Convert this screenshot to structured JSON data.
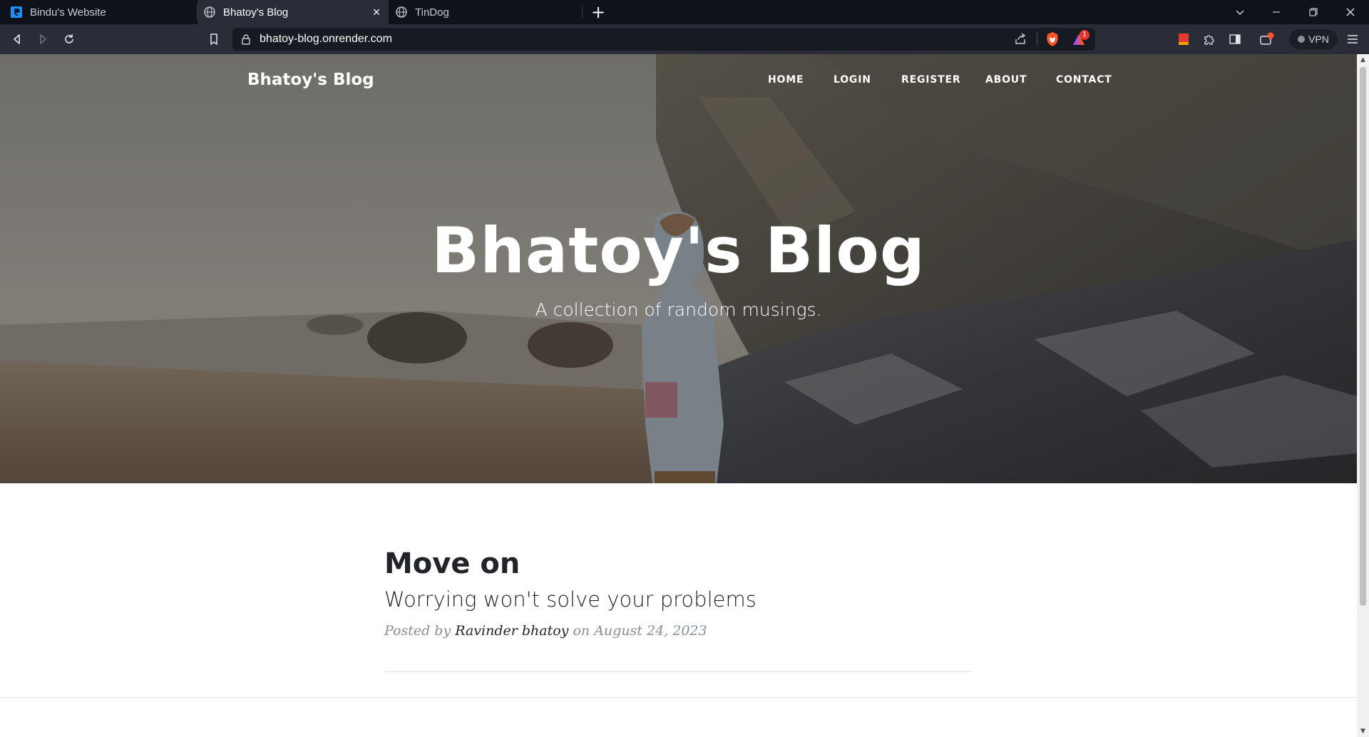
{
  "browser": {
    "tabs": [
      {
        "title": "Bindu's Website",
        "icon": "replit-icon",
        "active": false
      },
      {
        "title": "Bhatoy's Blog",
        "icon": "globe-icon",
        "active": true
      },
      {
        "title": "TinDog",
        "icon": "globe-icon",
        "active": false
      }
    ],
    "url": "bhatoy-blog.onrender.com",
    "vpn_label": "VPN",
    "notification_badge": "1",
    "colors": {
      "tabbar": "#10121a",
      "toolbar": "#2a2d38",
      "brave_orange": "#fb542b"
    }
  },
  "site": {
    "brand": "Bhatoy's Blog",
    "nav": [
      "HOME",
      "LOGIN",
      "REGISTER",
      "ABOUT",
      "CONTACT"
    ],
    "hero": {
      "title": "Bhatoy's Blog",
      "subtitle": "A collection of random musings."
    },
    "posts": [
      {
        "title": "Move on",
        "subtitle": "Worrying won't solve your problems",
        "posted_by_label": "Posted by",
        "author": "Ravinder bhatoy",
        "on_label": "on",
        "date": "August 24, 2023"
      }
    ]
  }
}
